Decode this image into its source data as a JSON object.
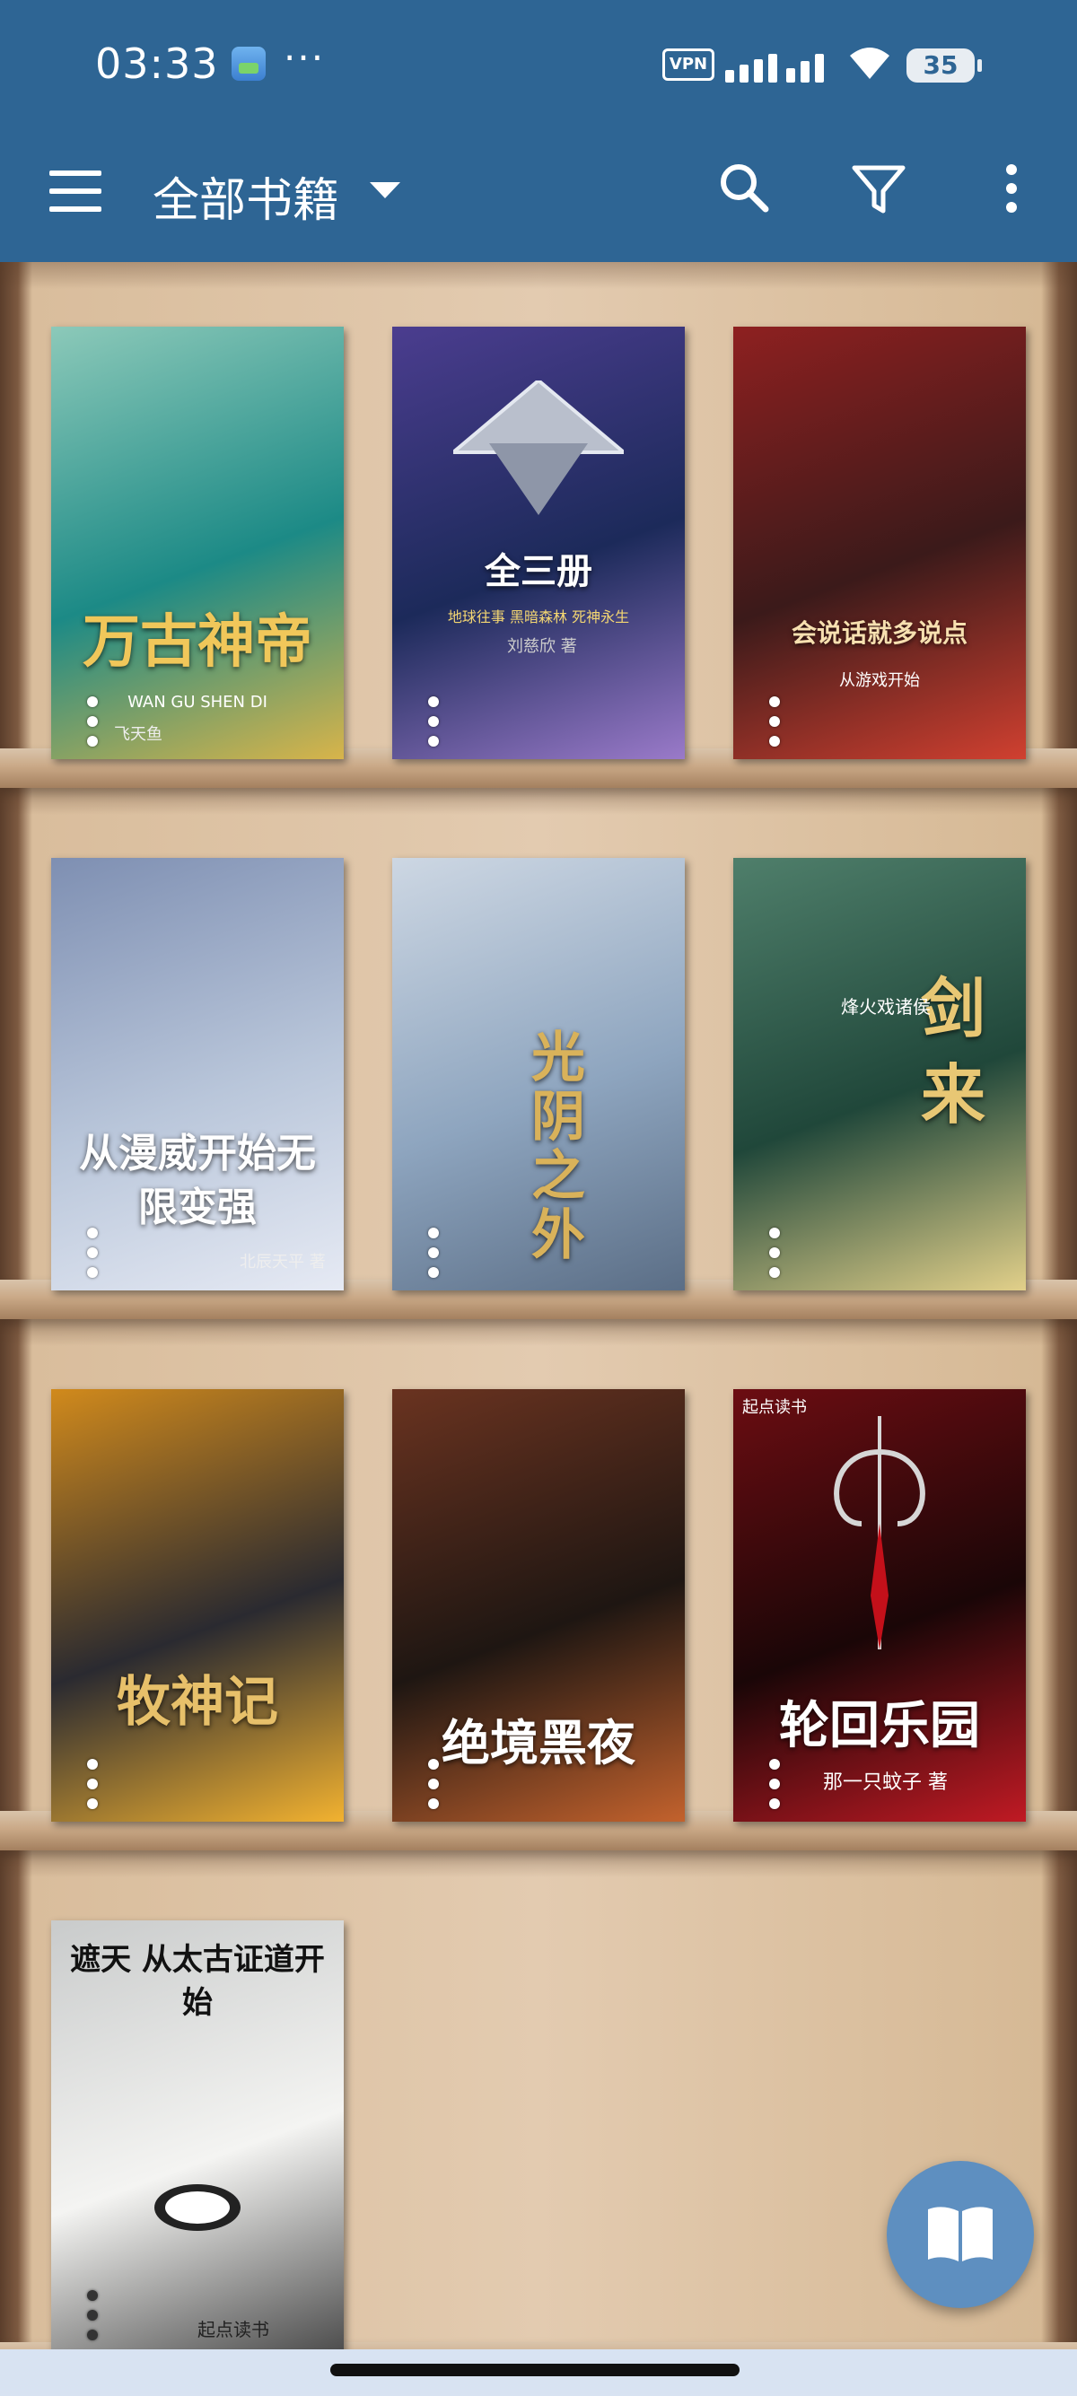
{
  "status_bar": {
    "time": "03:33",
    "dots": "···",
    "vpn": "VPN",
    "battery": "35"
  },
  "toolbar": {
    "title": "全部书籍",
    "menu_icon": "hamburger-menu-icon",
    "dropdown_icon": "caret-down-icon",
    "search_icon": "search-icon",
    "filter_icon": "filter-icon",
    "more_icon": "more-vertical-icon"
  },
  "books": [
    {
      "title": "万古神帝",
      "subtitle": "WAN GU SHEN DI",
      "author": "飞天鱼",
      "colors": [
        "#1c8a86",
        "#8cc9b9",
        "#d8b44a"
      ]
    },
    {
      "title": "全三册",
      "subtitle": "地球往事 黑暗森林 死神永生",
      "author": "刘慈欣 著",
      "colors": [
        "#1c2a5a",
        "#4b3d8f",
        "#9a7ac9"
      ]
    },
    {
      "title": "会说话就多说点",
      "subtitle": "从游戏开始",
      "author": "",
      "colors": [
        "#3b1a1a",
        "#8e2020",
        "#d04030"
      ]
    },
    {
      "title": "从漫威开始无限变强",
      "subtitle": "",
      "author": "北辰天平 著",
      "colors": [
        "#b9c6da",
        "#7e8fb2",
        "#e6eaf4"
      ]
    },
    {
      "title": "光阴之外",
      "subtitle": "",
      "author": "",
      "colors": [
        "#8ea5bf",
        "#cdd7e3",
        "#5b6e86"
      ]
    },
    {
      "title": "剑来",
      "subtitle": "烽火戏诸侯",
      "author": "",
      "colors": [
        "#20473a",
        "#4f7f6b",
        "#e2d08a"
      ]
    },
    {
      "title": "牧神记",
      "subtitle": "",
      "author": "",
      "colors": [
        "#2a2a30",
        "#d18a1c",
        "#f2b230"
      ]
    },
    {
      "title": "绝境黑夜",
      "subtitle": "",
      "author": "",
      "colors": [
        "#1e1612",
        "#6a3320",
        "#c3622d"
      ]
    },
    {
      "title": "轮回乐园",
      "subtitle": "起点读书",
      "author": "那一只蚊子 著",
      "colors": [
        "#1a0607",
        "#6c0d12",
        "#c01a24"
      ]
    },
    {
      "title": "遮天 从太古证道开始",
      "subtitle": "起点读书",
      "author": "",
      "colors": [
        "#f4f4f2",
        "#c9cbcb",
        "#4c4c4c"
      ]
    }
  ],
  "fab": {
    "icon": "open-book-icon"
  }
}
